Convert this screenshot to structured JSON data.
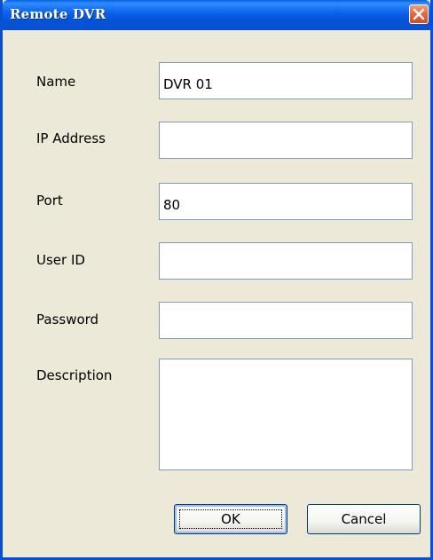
{
  "window": {
    "title": "Remote DVR"
  },
  "fields": {
    "name": {
      "label": "Name",
      "value": "DVR 01"
    },
    "ip_address": {
      "label": "IP Address",
      "value": ""
    },
    "port": {
      "label": "Port",
      "value": "80"
    },
    "user_id": {
      "label": "User ID",
      "value": ""
    },
    "password": {
      "label": "Password",
      "value": ""
    },
    "description": {
      "label": "Description",
      "value": ""
    }
  },
  "buttons": {
    "ok_label": "OK",
    "cancel_label": "Cancel"
  },
  "icons": {
    "close": "close-icon"
  },
  "colors": {
    "titlebar": "#0a5fe0",
    "close_button": "#e46a3f",
    "dialog_background": "#ece9d8",
    "input_border": "#7f9db9"
  }
}
